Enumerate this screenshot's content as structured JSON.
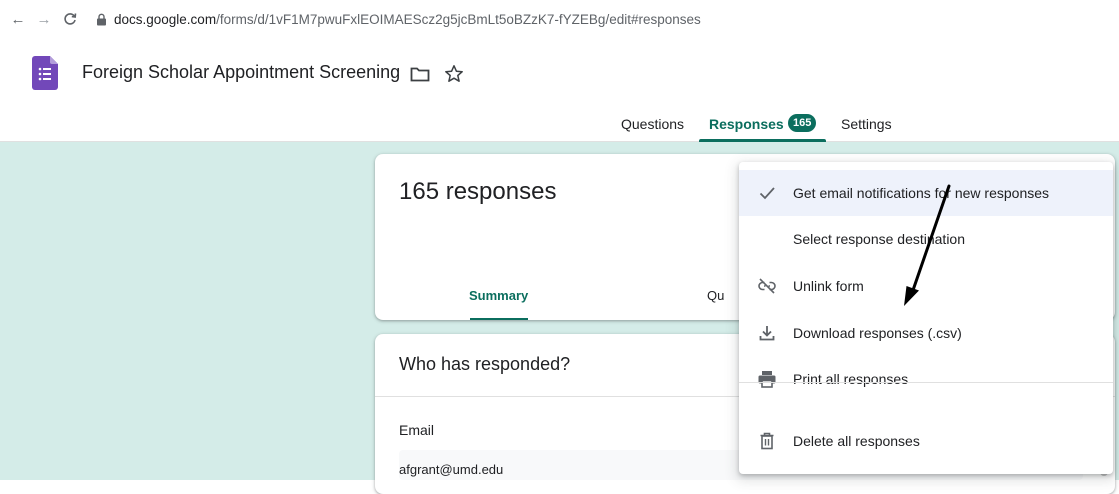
{
  "browser": {
    "url_host": "docs.google.com",
    "url_path": "/forms/d/1vF1M7pwuFxlEOIMAEScz2g5jcBmLt5oBZzK7-fYZEBg/edit#responses"
  },
  "form": {
    "title": "Foreign Scholar Appointment Screening",
    "tabs": [
      {
        "label": "Questions"
      },
      {
        "label": "Responses",
        "badge": "165"
      },
      {
        "label": "Settings"
      }
    ]
  },
  "summary_card": {
    "count_text": "165 responses",
    "sub_tabs": [
      {
        "label": "Summary"
      },
      {
        "label": "Qu"
      }
    ]
  },
  "who_card": {
    "title": "Who has responded?",
    "column": "Email",
    "rows": [
      "afgrant@umd.edu"
    ]
  },
  "menu": {
    "items": [
      {
        "label": "Get email notifications for new responses",
        "icon": "check-icon"
      },
      {
        "label": "Select response destination",
        "icon": ""
      },
      {
        "label": "Unlink form",
        "icon": "unlink-icon"
      },
      {
        "label": "Download responses (.csv)",
        "icon": "download-icon"
      },
      {
        "label": "Print all responses",
        "icon": "print-icon"
      },
      {
        "label": "Delete all responses",
        "icon": "trash-icon"
      }
    ]
  },
  "colors": {
    "accent": "#0b6e5e",
    "canvas": "#d4ece8",
    "forms_brand": "#7248b9"
  }
}
